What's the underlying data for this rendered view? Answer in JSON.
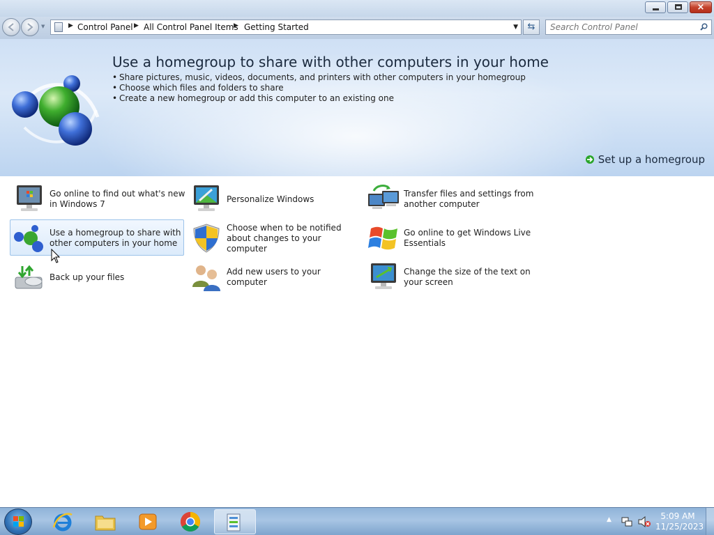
{
  "window": {
    "minimize_label": "",
    "maximize_label": "",
    "close_label": "×"
  },
  "address_bar": {
    "breadcrumbs": [
      "Control Panel",
      "All Control Panel Items",
      "Getting Started"
    ]
  },
  "search": {
    "placeholder": "Search Control Panel"
  },
  "banner": {
    "title": "Use a homegroup to share with other computers in your home",
    "bullets": [
      "Share pictures, music, videos, documents, and printers with other computers in your homegroup",
      "Choose which files and folders to share",
      "Create a new homegroup or add this computer to an existing one"
    ],
    "action_link": "Set up a homegroup"
  },
  "tasks": [
    {
      "label": "Go online to find out what's new in Windows 7",
      "icon": "windows7-monitor-icon"
    },
    {
      "label": "Personalize Windows",
      "icon": "personalize-monitor-icon"
    },
    {
      "label": "Transfer files and settings from another computer",
      "icon": "transfer-computers-icon"
    },
    {
      "label": "Use a homegroup to share with other computers in your home",
      "icon": "homegroup-icon"
    },
    {
      "label": "Choose when to be notified about changes to your computer",
      "icon": "uac-shield-icon"
    },
    {
      "label": "Go online to get Windows Live Essentials",
      "icon": "windows-flag-icon"
    },
    {
      "label": "Back up your files",
      "icon": "backup-icon"
    },
    {
      "label": "Add new users to your computer",
      "icon": "users-icon"
    },
    {
      "label": "Change the size of the text on your screen",
      "icon": "display-text-size-icon"
    }
  ],
  "hovered_task": "Use a homegroup to share with other computers in your home",
  "taskbar": {
    "pinned": [
      "internet-explorer-icon",
      "windows-explorer-icon",
      "media-player-icon",
      "chrome-icon",
      "control-panel-icon"
    ],
    "active": "control-panel-icon",
    "clock_time": "5:09 AM",
    "clock_date": "11/25/2023"
  },
  "colors": {
    "banner_bg": "#cfe0f5",
    "hover_border": "#9cc3ea",
    "taskbar_bg": "#8fb3d9"
  }
}
